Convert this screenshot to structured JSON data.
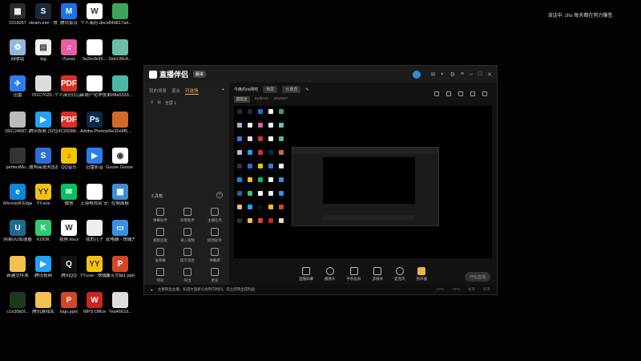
{
  "desktop": {
    "notice": "谈话中: zhu  每天都在努力赚签.",
    "icons": [
      {
        "label": "2016057",
        "color": "#2b2b2b",
        "glyph": "▦"
      },
      {
        "label": "steam.exe - 快捷方式",
        "color": "#1b2838",
        "glyph": "S"
      },
      {
        "label": "腾讯会议",
        "color": "#1a73e8",
        "glyph": "M"
      },
      {
        "label": "个人简历.docx",
        "color": "#ffffff",
        "glyph": "W"
      },
      {
        "label": "84d817ad...",
        "color": "#3fa35a",
        "glyph": ""
      },
      {
        "label": "回收站",
        "color": "#8fb8de",
        "glyph": "♻"
      },
      {
        "label": "log",
        "color": "#f0f0f0",
        "glyph": "▤"
      },
      {
        "label": "iTunes",
        "color": "#e45fa8",
        "glyph": "♫"
      },
      {
        "label": "0a2ecfe95...",
        "color": "#ffffff",
        "glyph": ""
      },
      {
        "label": "2eb139c4...",
        "color": "#6bbfa8",
        "glyph": ""
      },
      {
        "label": "迅雷",
        "color": "#2b7de9",
        "glyph": "✈"
      },
      {
        "label": "701C7020...",
        "color": "#dddddd",
        "glyph": ""
      },
      {
        "label": "个人简历(1).pdf",
        "color": "#d93025",
        "glyph": "PDF"
      },
      {
        "label": "江财产化学技术分析(3)...",
        "color": "#ffffff",
        "glyph": ""
      },
      {
        "label": "699fa5333...",
        "color": "#4cb7a5",
        "glyph": ""
      },
      {
        "label": "DEC24687...",
        "color": "#bbbbbb",
        "glyph": ""
      },
      {
        "label": "腾讯视频 (32位) - 快捷...",
        "color": "#1fa2ff",
        "glyph": "▶"
      },
      {
        "label": "4C26388...",
        "color": "#d93025",
        "glyph": "PDF"
      },
      {
        "label": "Adobe Photoshop",
        "color": "#0b2a4a",
        "glyph": "Ps"
      },
      {
        "label": "6e32e9f6...",
        "color": "#d16b2a",
        "glyph": ""
      },
      {
        "label": "perfectMo...",
        "color": "#333333",
        "glyph": ""
      },
      {
        "label": "搜狗高速浏览器",
        "color": "#2a6fd6",
        "glyph": "S"
      },
      {
        "label": "QQ音乐",
        "color": "#f5c400",
        "glyph": "♪"
      },
      {
        "label": "迅雷影音",
        "color": "#2b7de9",
        "glyph": "▶"
      },
      {
        "label": "Goose Goose Duck",
        "color": "#ffffff",
        "glyph": "◉"
      },
      {
        "label": "Microsoft Edge",
        "color": "#0c88d8",
        "glyph": "e"
      },
      {
        "label": "YY.exe",
        "color": "#f4c20d",
        "glyph": "YY"
      },
      {
        "label": "微信",
        "color": "#07c160",
        "glyph": "✉"
      },
      {
        "label": "上海电视台 安全管理...",
        "color": "#ffffff",
        "glyph": ""
      },
      {
        "label": "控制面板",
        "color": "#3c8fd6",
        "glyph": "▦"
      },
      {
        "label": "网易UU加速器",
        "color": "#1c6b8f",
        "glyph": "U"
      },
      {
        "label": "KOOK",
        "color": "#2ecc71",
        "glyph": "K"
      },
      {
        "label": "我爸.docx",
        "color": "#ffffff",
        "glyph": "W"
      },
      {
        "label": "我的儿子",
        "color": "#eeeeee",
        "glyph": ""
      },
      {
        "label": "此电脑 - 快捷方式",
        "color": "#3a8ee6",
        "glyph": "▭"
      },
      {
        "label": "新建文件夹",
        "color": "#f2c14e",
        "glyph": ""
      },
      {
        "label": "腾讯视频",
        "color": "#1fa2ff",
        "glyph": "▶"
      },
      {
        "label": "腾讯QQ",
        "color": "#111111",
        "glyph": "Q"
      },
      {
        "label": "YY.exe - 快捷方式",
        "color": "#f4c20d",
        "glyph": "YY"
      },
      {
        "label": "演示文稿1.pptx",
        "color": "#d24726",
        "glyph": "P"
      },
      {
        "label": "c1e30b0f...",
        "color": "#1e3a1e",
        "glyph": ""
      },
      {
        "label": "腾讯游戏库",
        "color": "#f2c14e",
        "glyph": ""
      },
      {
        "label": "logo.pptx",
        "color": "#d24726",
        "glyph": "P"
      },
      {
        "label": "WPS Office",
        "color": "#c9261f",
        "glyph": "W"
      },
      {
        "label": "7ea4661d...",
        "color": "#dddddd",
        "glyph": ""
      }
    ]
  },
  "app": {
    "title": "直播伴侣",
    "version_badge": "版本",
    "left_tabs": [
      "我的场景",
      "混合",
      "可选场"
    ],
    "scene_row": [
      "⚲",
      "⊞",
      "全屏 1"
    ],
    "tools_title": "工具箱",
    "tools_plus": "+",
    "tools": [
      "弹幕助手",
      "房管助手",
      "主播任务",
      "视频连麦",
      "录入视频",
      "修改助手",
      "设弹幕",
      "提示消息",
      "弹幕库",
      "特效",
      "导出",
      "更多"
    ],
    "scene_name": "今晚的dx网吧",
    "scene_chip": "横屏",
    "scene_label": "长期直",
    "sub_items": [
      "圆黑合",
      "SwiftAsC",
      "2016057"
    ],
    "bottom_buttons": [
      "直播屏幕",
      "摄像头",
      "手机投屏",
      "多媒体",
      "麦克风",
      "扬声器"
    ],
    "go_live": "开始直播",
    "status_text": "主要转出主播，知道文旅新公会列内时间，适立即转出得利益",
    "status_stats": [
      "CPU",
      "GPU",
      "帧率",
      "码率"
    ]
  },
  "colors": {
    "accent": "#f3b04b",
    "brand": "#2a8fd8"
  }
}
